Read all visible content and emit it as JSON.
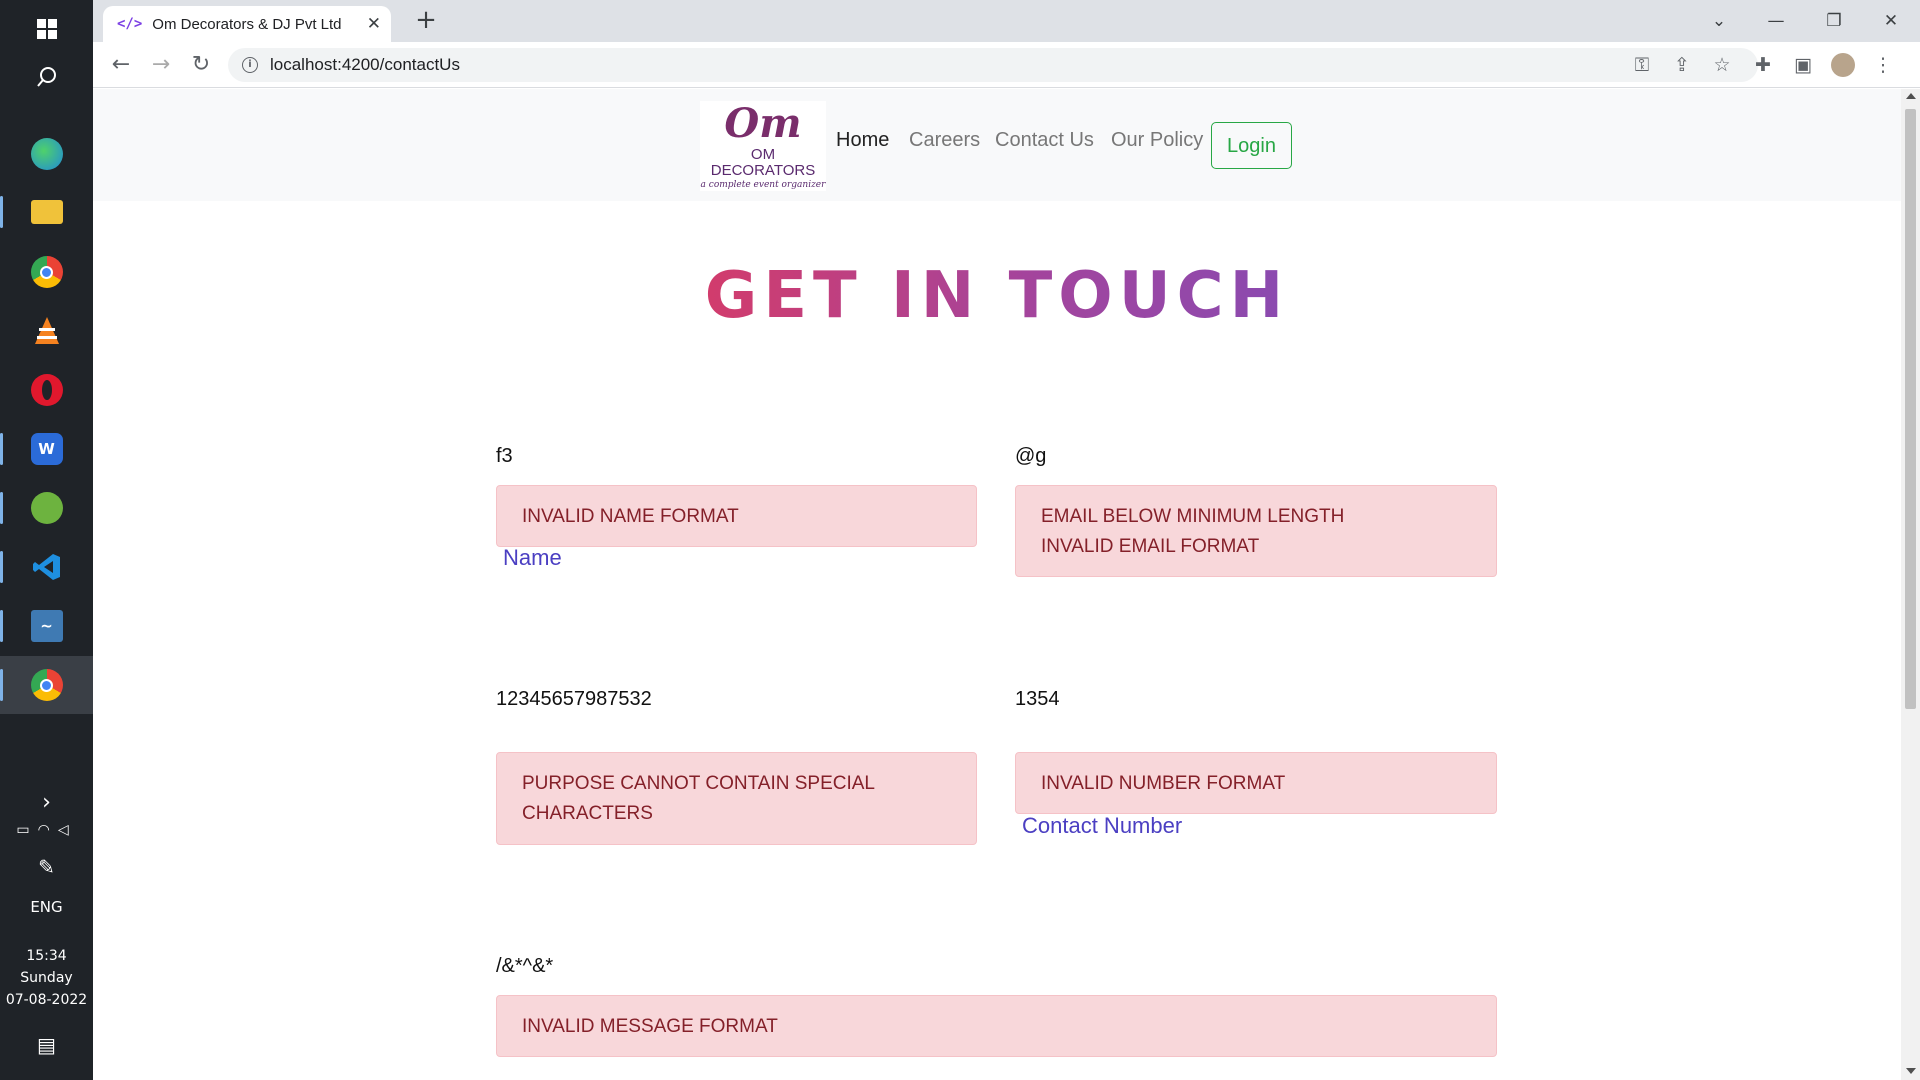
{
  "taskbar": {
    "apps": [
      {
        "name": "start",
        "color": "#ffffff"
      },
      {
        "name": "search",
        "color": "#ffffff"
      },
      {
        "name": "edge",
        "color": "#1fa3e0"
      },
      {
        "name": "file-explorer",
        "color": "#f0c23a"
      },
      {
        "name": "chrome",
        "color": "#dd4b39"
      },
      {
        "name": "vlc",
        "color": "#f58220"
      },
      {
        "name": "opera",
        "color": "#e0182d"
      },
      {
        "name": "word",
        "color": "#2b6bd8"
      },
      {
        "name": "spring-tool",
        "color": "#6db33f"
      },
      {
        "name": "vscode",
        "color": "#1e8fe0"
      },
      {
        "name": "mysql-workbench",
        "color": "#3f7ab3"
      },
      {
        "name": "chrome-profile",
        "color": "#dd4b39"
      }
    ],
    "language": "ENG",
    "time": "15:34",
    "day": "Sunday",
    "date": "07-08-2022"
  },
  "browser": {
    "tab_title": "Om Decorators & DJ Pvt Ltd",
    "url": "localhost:4200/contactUs"
  },
  "site": {
    "logo_mark": "Om",
    "logo_name": "OM DECORATORS",
    "logo_tagline": "a complete event organizer",
    "nav": {
      "home": "Home",
      "careers": "Careers",
      "contact": "Contact Us",
      "policy": "Our Policy",
      "login": "Login"
    },
    "heading": "GET IN TOUCH"
  },
  "form": {
    "name": {
      "value": "f3",
      "errors": [
        "INVALID NAME FORMAT"
      ],
      "label": "Name"
    },
    "email": {
      "value": "@g",
      "errors": [
        "EMAIL BELOW MINIMUM LENGTH",
        "INVALID EMAIL FORMAT"
      ]
    },
    "purpose": {
      "value": "12345657987532",
      "errors": [
        "PURPOSE CANNOT CONTAIN SPECIAL",
        "CHARACTERS"
      ]
    },
    "contact": {
      "value": "1354",
      "errors": [
        "INVALID NUMBER FORMAT"
      ],
      "label": "Contact Number"
    },
    "message": {
      "value": "/&*^&*",
      "errors": [
        "INVALID MESSAGE FORMAT"
      ]
    }
  },
  "colors": {
    "alert_bg": "#f8d7da",
    "alert_text": "#842029",
    "login_green": "#28a745",
    "label_purple": "#4b3fc2"
  }
}
